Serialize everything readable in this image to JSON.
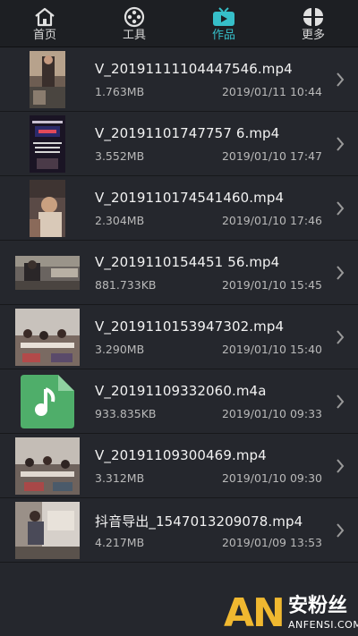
{
  "tabs": [
    {
      "label": "首页",
      "icon": "home-icon",
      "active": false
    },
    {
      "label": "工具",
      "icon": "film-reel-icon",
      "active": false
    },
    {
      "label": "作品",
      "icon": "tv-play-icon",
      "active": true
    },
    {
      "label": "更多",
      "icon": "grid-more-icon",
      "active": false
    }
  ],
  "colors": {
    "accent": "#36bfc9",
    "background": "#25272d",
    "music_file": "#4fae6a"
  },
  "files": [
    {
      "name": "V_20191111104447546.mp4",
      "size": "1.763MB",
      "date": "2019/01/11 10:44",
      "thumb": "video"
    },
    {
      "name": "V_20191101747757 6.mp4",
      "size": "3.552MB",
      "date": "2019/01/10 17:47",
      "thumb": "video"
    },
    {
      "name": "V_2019110174541460.mp4",
      "size": "2.304MB",
      "date": "2019/01/10 17:46",
      "thumb": "video"
    },
    {
      "name": "V_2019110154451 56.mp4",
      "size": "881.733KB",
      "date": "2019/01/10 15:45",
      "thumb": "video"
    },
    {
      "name": "V_2019110153947302.mp4",
      "size": "3.290MB",
      "date": "2019/01/10 15:40",
      "thumb": "video"
    },
    {
      "name": "V_20191109332060.m4a",
      "size": "933.835KB",
      "date": "2019/01/10 09:33",
      "thumb": "music"
    },
    {
      "name": "V_20191109300469.mp4",
      "size": "3.312MB",
      "date": "2019/01/10 09:30",
      "thumb": "video"
    },
    {
      "name": "抖音导出_1547013209078.mp4",
      "size": "4.217MB",
      "date": "2019/01/09 13:53",
      "thumb": "video"
    }
  ],
  "watermark": {
    "letters": "AN",
    "cn": "安粉丝",
    "en": "ANFENSI.COM"
  }
}
